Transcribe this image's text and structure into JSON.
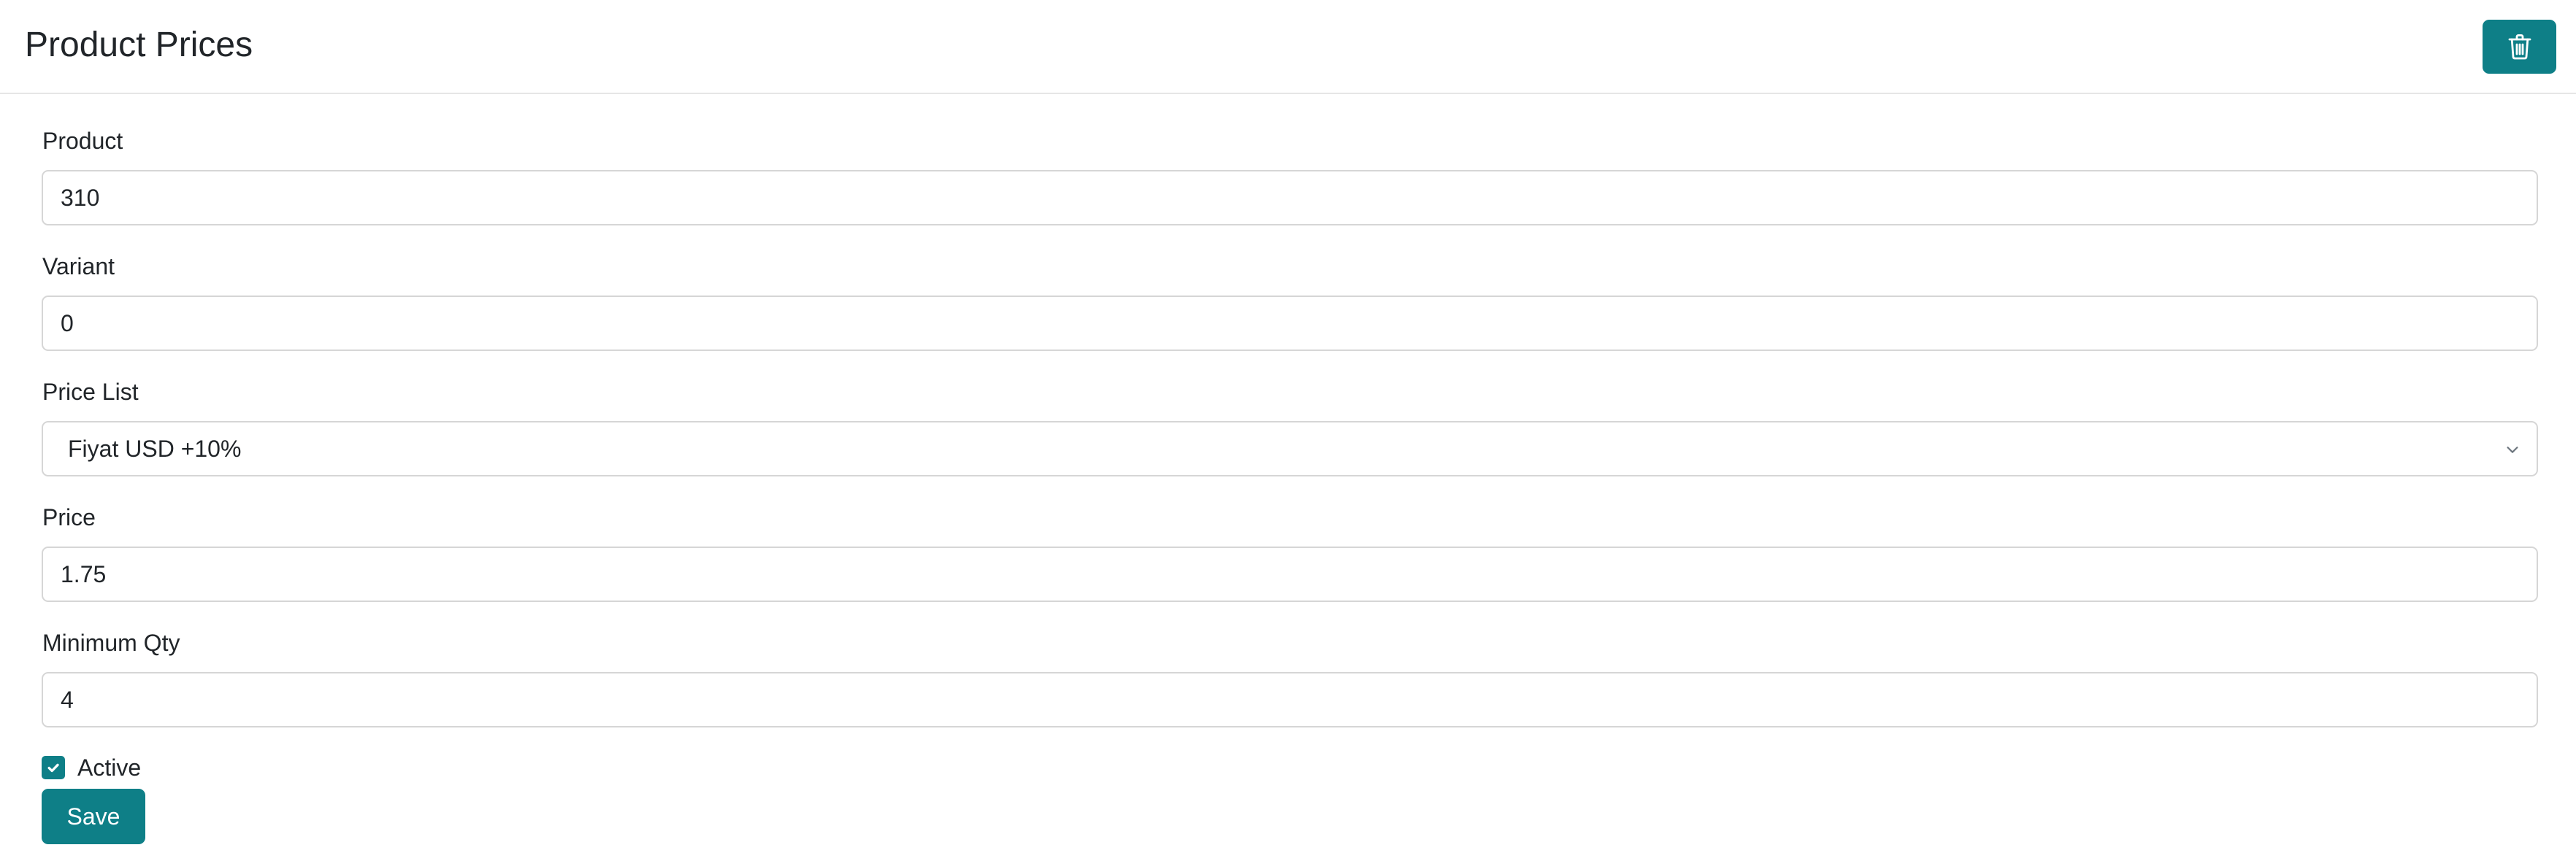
{
  "header": {
    "title": "Product Prices",
    "delete_icon": "trash-icon",
    "accent_color": "#0e7f87"
  },
  "form": {
    "product": {
      "label": "Product",
      "value": "310"
    },
    "variant": {
      "label": "Variant",
      "value": "0"
    },
    "price_list": {
      "label": "Price List",
      "value": "Fiyat USD +10%",
      "icon": "chevron-down-icon"
    },
    "price": {
      "label": "Price",
      "value": "1.75"
    },
    "minimum_qty": {
      "label": "Minimum Qty",
      "value": "4"
    },
    "active": {
      "label": "Active",
      "checked": true
    },
    "save_label": "Save"
  }
}
